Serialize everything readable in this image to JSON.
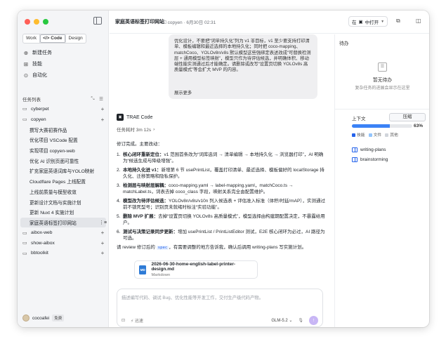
{
  "sidebar": {
    "modes": [
      "Work",
      "</> Code",
      "Design"
    ],
    "nav": [
      {
        "icon": "new-task-icon",
        "glyph": "⊕",
        "label": "新建任务"
      },
      {
        "icon": "skills-icon",
        "glyph": "⊞",
        "label": "技能"
      },
      {
        "icon": "automation-icon",
        "glyph": "⊙",
        "label": "自动化"
      }
    ],
    "tasks_title": "任务列表",
    "tree": [
      {
        "label": "cyberpet",
        "type": "folder"
      },
      {
        "label": "copyen",
        "type": "folder"
      },
      {
        "label": "撰写大赛初赛作品",
        "type": "task"
      },
      {
        "label": "优化项目 VSCode 配置",
        "type": "task"
      },
      {
        "label": "实现项目 copyen-web",
        "type": "task"
      },
      {
        "label": "优化 AI 识别页面可靠性",
        "type": "task"
      },
      {
        "label": "扩充家庭英语词库与YOLO映射",
        "type": "task"
      },
      {
        "label": "Cloudflare Pages 上线配置",
        "type": "task"
      },
      {
        "label": "上线前质量与模型收敛",
        "type": "task"
      },
      {
        "label": "更新设计文档与实施计划",
        "type": "task"
      },
      {
        "label": "更新 Nuxt 4 实施计划",
        "type": "task"
      },
      {
        "label": "家庭英语标签打印网站",
        "type": "task",
        "selected": true
      },
      {
        "label": "aibox-web",
        "type": "folder"
      },
      {
        "label": "show-aibox",
        "type": "folder"
      },
      {
        "label": "bbtoolkit",
        "type": "folder"
      }
    ],
    "user": {
      "name": "cocoafei",
      "badge": "免费"
    }
  },
  "header": {
    "title": "家庭英语标签打印网站",
    "meta": "☐ copyen · 6月30日 02:31",
    "open_prefix": "在",
    "open_label": "中打开"
  },
  "chat": {
    "bubble": "优化设计，不要把“词单持久化”列为 v1 非目标，v1 至少要支持打印清单、模板编辑和最近选择的本地持久化；同时把 coco-mapping、matchCoco、YOLOv8n/v8s 默认模型这些强绑定表述改成“可替换检测层 + 通用模型标签映射”，模型只作为待评估候选，并明确体积、移动端性能实测通过后才能确定。请删除或改写“设置页切换 YOLOv8s 高质量模式”等会扩大 MVP 的内容。",
    "expand": "展示更多",
    "agent_name": "TRAE Code",
    "took": "任务耗时 3m 12s",
    "intro": "修订完成。主要改动：",
    "items": [
      {
        "n": "1.",
        "b": "核心闭环重新定位：",
        "t": "v1 范围首条改为“词库选词 → 清单编辑 → 本地持久化 → 浏览器打印”，AI 明确为“候选生成与降级增强”。"
      },
      {
        "n": "2.",
        "b": "本地持久化进 v1：",
        "t": "新增第 6 节 usePrintList，覆盖打印清单、最近选择、模板偏好的 localStorage 持久化、迁移策略和隐私保护。"
      },
      {
        "n": "3.",
        "b": "检测层与映射层解耦：",
        "t": "coco-mapping.yaml → label-mapping.yaml，matchCoco.ts → matchLabel.ts，词表去掉 coco_class 字段，映射关系完全由配置维护。"
      },
      {
        "n": "4.",
        "b": "模型改为待评估候选：",
        "t": "YOLOv8n/v8s/v10n 列入候选表 + 评估准入标准（体积/时延/mAP），实测通过前不锁死型号；识别页未就绪时标注“实验功能”。"
      },
      {
        "n": "5.",
        "b": "删除 MVP 扩展：",
        "t": "去掉“设置页切换 YOLOv8s 高质量模式”，模型选择由构建期配置决定，不暴露给用户。"
      },
      {
        "n": "6.",
        "b": "测试与决策记录同步更新：",
        "t": "增加 usePrintList / PrintListEditor 测试，E2E 核心闭环为必过，AI 路径为可选。"
      }
    ],
    "outro_a": "请 review 修订后的",
    "outro_spec": "spec",
    "outro_b": "，有需要调整的地方告诉我，确认后调用 writing-plans 写实施计划。",
    "file_name": "2026-06-30-home-english-label-printer-design.md",
    "file_type": "Markdown",
    "file_badge": "MD",
    "composer_placeholder": "描述编写代码、调试 Bug、优化性能等开发工作，交付生产级代码产物。",
    "composer_speed": "⚡ 迅速",
    "composer_model": "GLM-5.2 ⌄"
  },
  "rpanel": {
    "title": "待办",
    "empty_title": "暂无待办",
    "empty_sub": "复杂任务的进展会显示在这里",
    "ctx_label": "上下文",
    "compress": "压缩",
    "pct_text": "63%",
    "pct": 63,
    "legend": [
      {
        "label": "技能",
        "color": "#2563eb"
      },
      {
        "label": "文件",
        "color": "#93c5fd"
      },
      {
        "label": "其他",
        "color": "#d1d5db"
      }
    ],
    "files": [
      "writing-plans",
      "brainstorming"
    ]
  },
  "colors": {
    "accent": "#3b82f6",
    "send": "#c8b6f5"
  }
}
